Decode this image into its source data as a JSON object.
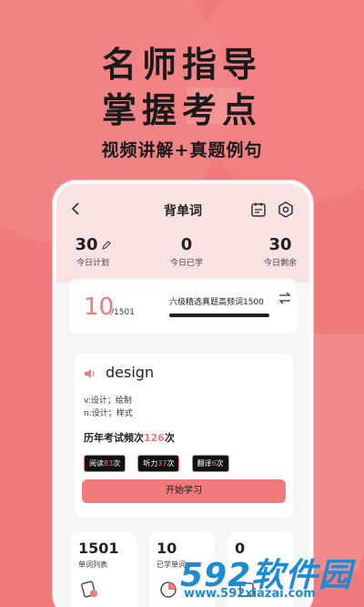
{
  "headline": {
    "line1": "名师指导",
    "line2": "掌握考点",
    "line3": "视频讲解+真题例句"
  },
  "nav": {
    "back_icon": "chevron-left-icon",
    "title": "背单词",
    "calendar_icon": "calendar-icon",
    "settings_icon": "hexagon-gear-icon"
  },
  "stats": [
    {
      "value": "30",
      "label": "今日计划"
    },
    {
      "value": "0",
      "label": "今日已学"
    },
    {
      "value": "30",
      "label": "今日剩余"
    }
  ],
  "plan": {
    "progress": "10",
    "total": "/1501",
    "book": "六级精选真题高频词1500",
    "swap_icon": "swap-arrows-icon"
  },
  "word": {
    "speaker_icon": "speaker-icon",
    "text": "design",
    "def1": "v:设计；绘制",
    "def2": "n:设计；样式",
    "freq_prefix": "历年考试频次",
    "freq_count": "126",
    "freq_suffix": "次",
    "tags": [
      {
        "name": "阅读",
        "count": "83",
        "unit": "次"
      },
      {
        "name": "听力",
        "count": "37",
        "unit": "次"
      },
      {
        "name": "翻译",
        "count": "6",
        "unit": "次"
      }
    ],
    "start_label": "开始学习"
  },
  "bottom": [
    {
      "value": "1501",
      "label": "单词列表",
      "icon": "word-list-icon"
    },
    {
      "value": "10",
      "label": "已学单词",
      "icon": "pie-chart-icon"
    },
    {
      "value": "0",
      "label": "",
      "icon": "book-icon"
    }
  ],
  "watermark": {
    "big": "592软件园",
    "small": "www.592xiazai.com"
  },
  "colors": {
    "background": "#f07a7c",
    "accent": "#f07a7c",
    "watermark": "#1e8ad2"
  }
}
